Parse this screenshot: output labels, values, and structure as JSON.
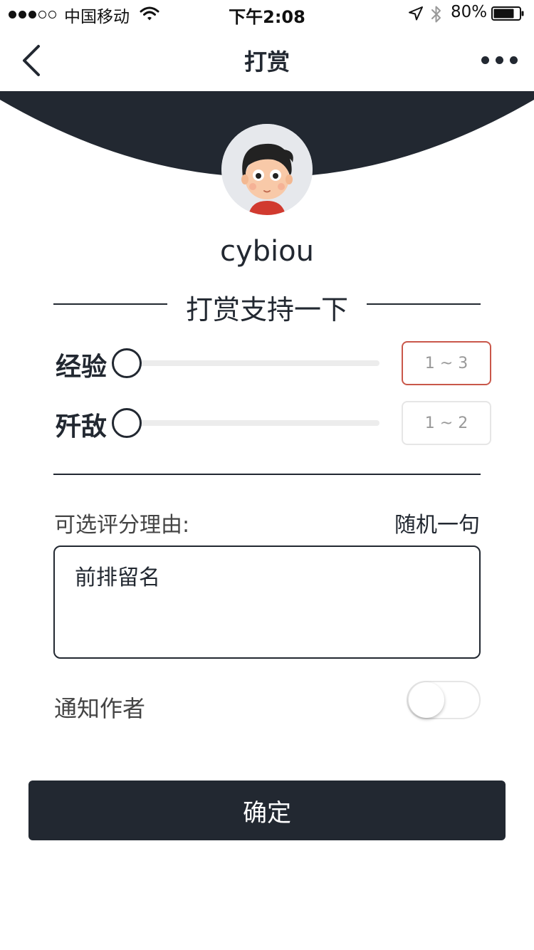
{
  "status_bar": {
    "carrier": "中国移动",
    "time": "下午2:08",
    "battery": "80%",
    "battery_level": 0.8,
    "signal_strength": 3,
    "signal_max": 5
  },
  "nav": {
    "title": "打赏",
    "back_icon": "chevron-left-icon",
    "more_icon": "more-dots-icon"
  },
  "profile": {
    "username": "cybiou",
    "avatar_icon": "cartoon-avatar"
  },
  "section_title": "打赏支持一下",
  "sliders": [
    {
      "label": "经验",
      "range": "1 ~ 3",
      "value": 0
    },
    {
      "label": "歼敌",
      "range": "1 ~ 2",
      "value": 0
    }
  ],
  "reason": {
    "label": "可选评分理由:",
    "random_link": "随机一句",
    "value": "前排留名"
  },
  "notify": {
    "label": "通知作者",
    "checked": false
  },
  "confirm_label": "确定",
  "colors": {
    "primary": "#222831",
    "highlight_border": "#c9574a",
    "track": "#ececec"
  }
}
